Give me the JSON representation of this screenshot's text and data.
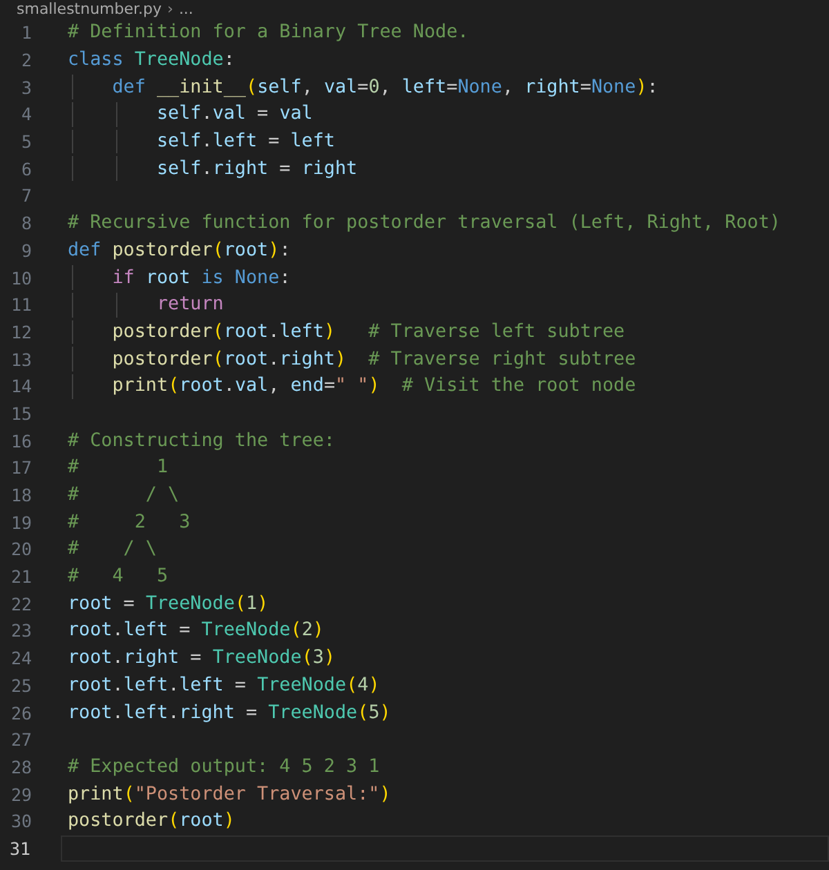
{
  "breadcrumb": {
    "file": "smallestnumber.py",
    "separator": "›",
    "rest": "..."
  },
  "lines": [
    {
      "number": "1",
      "selected": false,
      "tokens": [
        {
          "kind": "comment",
          "text": "# Definition for a Binary Tree Node."
        }
      ]
    },
    {
      "number": "2",
      "selected": false,
      "tokens": [
        {
          "kind": "keyword",
          "text": "class "
        },
        {
          "kind": "type",
          "text": "TreeNode"
        },
        {
          "kind": "plain",
          "text": ":"
        }
      ]
    },
    {
      "number": "3",
      "selected": false,
      "tokens": [
        {
          "kind": "keyword",
          "text": "    def "
        },
        {
          "kind": "function",
          "text": "__init__"
        },
        {
          "kind": "bracket",
          "text": "("
        },
        {
          "kind": "variable",
          "text": "self"
        },
        {
          "kind": "plain",
          "text": ", "
        },
        {
          "kind": "variable",
          "text": "val"
        },
        {
          "kind": "plain",
          "text": "="
        },
        {
          "kind": "number",
          "text": "0"
        },
        {
          "kind": "plain",
          "text": ", "
        },
        {
          "kind": "variable",
          "text": "left"
        },
        {
          "kind": "plain",
          "text": "="
        },
        {
          "kind": "keyword",
          "text": "None"
        },
        {
          "kind": "plain",
          "text": ", "
        },
        {
          "kind": "variable",
          "text": "right"
        },
        {
          "kind": "plain",
          "text": "="
        },
        {
          "kind": "keyword",
          "text": "None"
        },
        {
          "kind": "bracket",
          "text": ")"
        },
        {
          "kind": "plain",
          "text": ":"
        }
      ]
    },
    {
      "number": "4",
      "selected": false,
      "tokens": [
        {
          "kind": "variable",
          "text": "        self"
        },
        {
          "kind": "plain",
          "text": "."
        },
        {
          "kind": "variable",
          "text": "val"
        },
        {
          "kind": "plain",
          "text": " = "
        },
        {
          "kind": "variable",
          "text": "val"
        }
      ]
    },
    {
      "number": "5",
      "selected": false,
      "tokens": [
        {
          "kind": "variable",
          "text": "        self"
        },
        {
          "kind": "plain",
          "text": "."
        },
        {
          "kind": "variable",
          "text": "left"
        },
        {
          "kind": "plain",
          "text": " = "
        },
        {
          "kind": "variable",
          "text": "left"
        }
      ]
    },
    {
      "number": "6",
      "selected": false,
      "tokens": [
        {
          "kind": "variable",
          "text": "        self"
        },
        {
          "kind": "plain",
          "text": "."
        },
        {
          "kind": "variable",
          "text": "right"
        },
        {
          "kind": "plain",
          "text": " = "
        },
        {
          "kind": "variable",
          "text": "right"
        }
      ]
    },
    {
      "number": "7",
      "selected": false
    },
    {
      "number": "8",
      "selected": false,
      "tokens": [
        {
          "kind": "comment",
          "text": "# Recursive function for postorder traversal (Left, Right, Root)"
        }
      ]
    },
    {
      "number": "9",
      "selected": false,
      "tokens": [
        {
          "kind": "keyword",
          "text": "def "
        },
        {
          "kind": "function",
          "text": "postorder"
        },
        {
          "kind": "bracket",
          "text": "("
        },
        {
          "kind": "variable",
          "text": "root"
        },
        {
          "kind": "bracket",
          "text": ")"
        },
        {
          "kind": "plain",
          "text": ":"
        }
      ]
    },
    {
      "number": "10",
      "selected": false,
      "tokens": [
        {
          "kind": "control",
          "text": "    if "
        },
        {
          "kind": "variable",
          "text": "root "
        },
        {
          "kind": "keyword",
          "text": "is None"
        },
        {
          "kind": "plain",
          "text": ":"
        }
      ]
    },
    {
      "number": "11",
      "selected": false,
      "tokens": [
        {
          "kind": "control",
          "text": "        return"
        }
      ]
    },
    {
      "number": "12",
      "selected": false,
      "tokens": [
        {
          "kind": "function",
          "text": "    postorder"
        },
        {
          "kind": "bracket",
          "text": "("
        },
        {
          "kind": "variable",
          "text": "root"
        },
        {
          "kind": "plain",
          "text": "."
        },
        {
          "kind": "variable",
          "text": "left"
        },
        {
          "kind": "bracket",
          "text": ")"
        },
        {
          "kind": "comment",
          "text": "   # Traverse left subtree"
        }
      ]
    },
    {
      "number": "13",
      "selected": false,
      "tokens": [
        {
          "kind": "function",
          "text": "    postorder"
        },
        {
          "kind": "bracket",
          "text": "("
        },
        {
          "kind": "variable",
          "text": "root"
        },
        {
          "kind": "plain",
          "text": "."
        },
        {
          "kind": "variable",
          "text": "right"
        },
        {
          "kind": "bracket",
          "text": ")"
        },
        {
          "kind": "comment",
          "text": "  # Traverse right subtree"
        }
      ]
    },
    {
      "number": "14",
      "selected": false,
      "tokens": [
        {
          "kind": "function",
          "text": "    print"
        },
        {
          "kind": "bracket",
          "text": "("
        },
        {
          "kind": "variable",
          "text": "root"
        },
        {
          "kind": "plain",
          "text": "."
        },
        {
          "kind": "variable",
          "text": "val"
        },
        {
          "kind": "plain",
          "text": ", "
        },
        {
          "kind": "variable",
          "text": "end"
        },
        {
          "kind": "plain",
          "text": "="
        },
        {
          "kind": "string",
          "text": "\" \""
        },
        {
          "kind": "bracket",
          "text": ")"
        },
        {
          "kind": "comment",
          "text": "  # Visit the root node"
        }
      ]
    },
    {
      "number": "15",
      "selected": false
    },
    {
      "number": "16",
      "selected": false,
      "tokens": [
        {
          "kind": "comment",
          "text": "# Constructing the tree:"
        }
      ]
    },
    {
      "number": "17",
      "selected": false,
      "tokens": [
        {
          "kind": "comment",
          "text": "#       1"
        }
      ]
    },
    {
      "number": "18",
      "selected": false,
      "tokens": [
        {
          "kind": "comment",
          "text": "#      / \\"
        }
      ]
    },
    {
      "number": "19",
      "selected": false,
      "tokens": [
        {
          "kind": "comment",
          "text": "#     2   3"
        }
      ]
    },
    {
      "number": "20",
      "selected": false,
      "tokens": [
        {
          "kind": "comment",
          "text": "#    / \\"
        }
      ]
    },
    {
      "number": "21",
      "selected": false,
      "tokens": [
        {
          "kind": "comment",
          "text": "#   4   5"
        }
      ]
    },
    {
      "number": "22",
      "selected": false,
      "tokens": [
        {
          "kind": "variable",
          "text": "root"
        },
        {
          "kind": "plain",
          "text": " = "
        },
        {
          "kind": "type",
          "text": "TreeNode"
        },
        {
          "kind": "bracket",
          "text": "("
        },
        {
          "kind": "number",
          "text": "1"
        },
        {
          "kind": "bracket",
          "text": ")"
        }
      ]
    },
    {
      "number": "23",
      "selected": false,
      "tokens": [
        {
          "kind": "variable",
          "text": "root"
        },
        {
          "kind": "plain",
          "text": "."
        },
        {
          "kind": "variable",
          "text": "left"
        },
        {
          "kind": "plain",
          "text": " = "
        },
        {
          "kind": "type",
          "text": "TreeNode"
        },
        {
          "kind": "bracket",
          "text": "("
        },
        {
          "kind": "number",
          "text": "2"
        },
        {
          "kind": "bracket",
          "text": ")"
        }
      ]
    },
    {
      "number": "24",
      "selected": false,
      "tokens": [
        {
          "kind": "variable",
          "text": "root"
        },
        {
          "kind": "plain",
          "text": "."
        },
        {
          "kind": "variable",
          "text": "right"
        },
        {
          "kind": "plain",
          "text": " = "
        },
        {
          "kind": "type",
          "text": "TreeNode"
        },
        {
          "kind": "bracket",
          "text": "("
        },
        {
          "kind": "number",
          "text": "3"
        },
        {
          "kind": "bracket",
          "text": ")"
        }
      ]
    },
    {
      "number": "25",
      "selected": false,
      "tokens": [
        {
          "kind": "variable",
          "text": "root"
        },
        {
          "kind": "plain",
          "text": "."
        },
        {
          "kind": "variable",
          "text": "left"
        },
        {
          "kind": "plain",
          "text": "."
        },
        {
          "kind": "variable",
          "text": "left"
        },
        {
          "kind": "plain",
          "text": " = "
        },
        {
          "kind": "type",
          "text": "TreeNode"
        },
        {
          "kind": "bracket",
          "text": "("
        },
        {
          "kind": "number",
          "text": "4"
        },
        {
          "kind": "bracket",
          "text": ")"
        }
      ]
    },
    {
      "number": "26",
      "selected": false,
      "tokens": [
        {
          "kind": "variable",
          "text": "root"
        },
        {
          "kind": "plain",
          "text": "."
        },
        {
          "kind": "variable",
          "text": "left"
        },
        {
          "kind": "plain",
          "text": "."
        },
        {
          "kind": "variable",
          "text": "right"
        },
        {
          "kind": "plain",
          "text": " = "
        },
        {
          "kind": "type",
          "text": "TreeNode"
        },
        {
          "kind": "bracket",
          "text": "("
        },
        {
          "kind": "number",
          "text": "5"
        },
        {
          "kind": "bracket",
          "text": ")"
        }
      ]
    },
    {
      "number": "27",
      "selected": false
    },
    {
      "number": "28",
      "selected": false,
      "tokens": [
        {
          "kind": "comment",
          "text": "# Expected output: 4 5 2 3 1"
        }
      ]
    },
    {
      "number": "29",
      "selected": false,
      "tokens": [
        {
          "kind": "function",
          "text": "print"
        },
        {
          "kind": "bracket",
          "text": "("
        },
        {
          "kind": "string",
          "text": "\"Postorder Traversal:\""
        },
        {
          "kind": "bracket",
          "text": ")"
        }
      ]
    },
    {
      "number": "30",
      "selected": false,
      "tokens": [
        {
          "kind": "function",
          "text": "postorder"
        },
        {
          "kind": "bracket",
          "text": "("
        },
        {
          "kind": "variable",
          "text": "root"
        },
        {
          "kind": "bracket",
          "text": ")"
        }
      ]
    },
    {
      "number": "31",
      "selected": true
    }
  ]
}
